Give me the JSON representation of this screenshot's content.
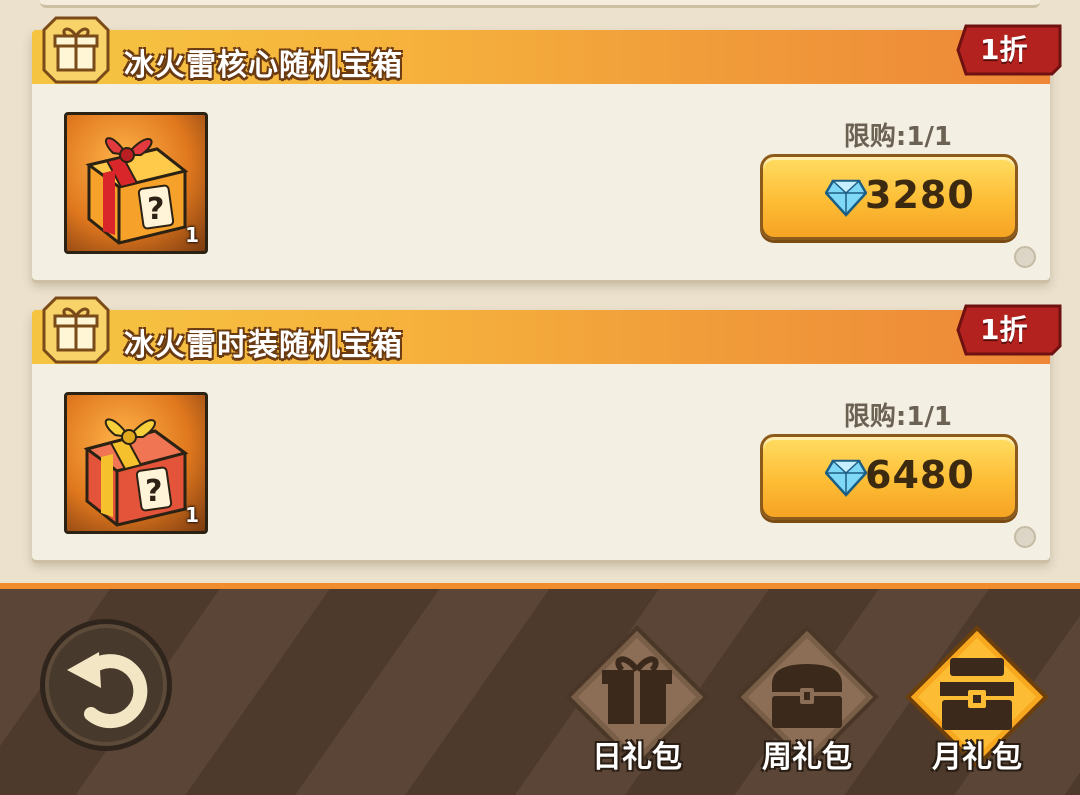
{
  "packs": [
    {
      "title": "冰火雷核心随机宝箱",
      "discount": "1折",
      "item_count": "1",
      "limit": "限购:1/1",
      "price": "3280",
      "item_icon": "red-ribbon-mystery-box-icon"
    },
    {
      "title": "冰火雷时装随机宝箱",
      "discount": "1折",
      "item_count": "1",
      "limit": "限购:1/1",
      "price": "6480",
      "item_icon": "gold-ribbon-mystery-box-icon"
    }
  ],
  "tabs": [
    {
      "label": "日礼包",
      "icon": "gift-box-icon",
      "active": false
    },
    {
      "label": "周礼包",
      "icon": "treasure-chest-icon",
      "active": false
    },
    {
      "label": "月礼包",
      "icon": "large-chest-icon",
      "active": true
    }
  ],
  "colors": {
    "accent_orange": "#f08c2c",
    "discount_red": "#b3221f",
    "button_gold": "#fdbd35",
    "gem_blue": "#5ec8f0"
  }
}
